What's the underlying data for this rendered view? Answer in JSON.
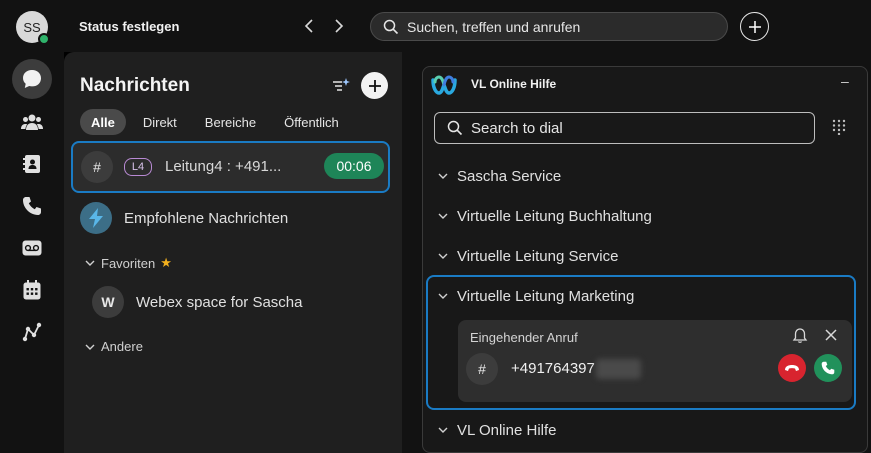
{
  "topbar": {
    "avatar_initials": "SS",
    "status_label": "Status festlegen",
    "search_placeholder": "Suchen, treffen und anrufen"
  },
  "rail": {
    "items": [
      "chat-icon",
      "people-icon",
      "contacts-icon",
      "phone-icon",
      "voicemail-icon",
      "calendar-icon",
      "analytics-icon"
    ],
    "active": "chat-icon"
  },
  "messages": {
    "title": "Nachrichten",
    "tabs": [
      {
        "label": "Alle",
        "active": true
      },
      {
        "label": "Direkt",
        "active": false
      },
      {
        "label": "Bereiche",
        "active": false
      },
      {
        "label": "Öffentlich",
        "active": false
      }
    ],
    "selected_row": {
      "hash": "#",
      "badge": "L4",
      "title": "Leitung4 : +491...",
      "timer": "00:06"
    },
    "recommended": "Empfohlene Nachrichten",
    "sections": {
      "favorites": "Favoriten",
      "others": "Andere"
    },
    "favorite_space": {
      "avatar": "W",
      "title": "Webex space for Sascha"
    }
  },
  "hilfe": {
    "title": "VL Online Hilfe",
    "minimize": "–",
    "dial_placeholder": "Search to dial",
    "lines": [
      "Sascha Service",
      "Virtuelle Leitung Buchhaltung",
      "Virtuelle Leitung Service",
      "Virtuelle Leitung Marketing",
      "VL Online Hilfe"
    ],
    "incoming": {
      "title": "Eingehender Anruf",
      "hash": "#",
      "number": "+491764397"
    }
  },
  "colors": {
    "accent_blue": "#1a7bc4",
    "timer_green": "#1e8558",
    "decline_red": "#d8242f",
    "accept_green": "#21915b",
    "favorite_star": "#f2b01e"
  }
}
